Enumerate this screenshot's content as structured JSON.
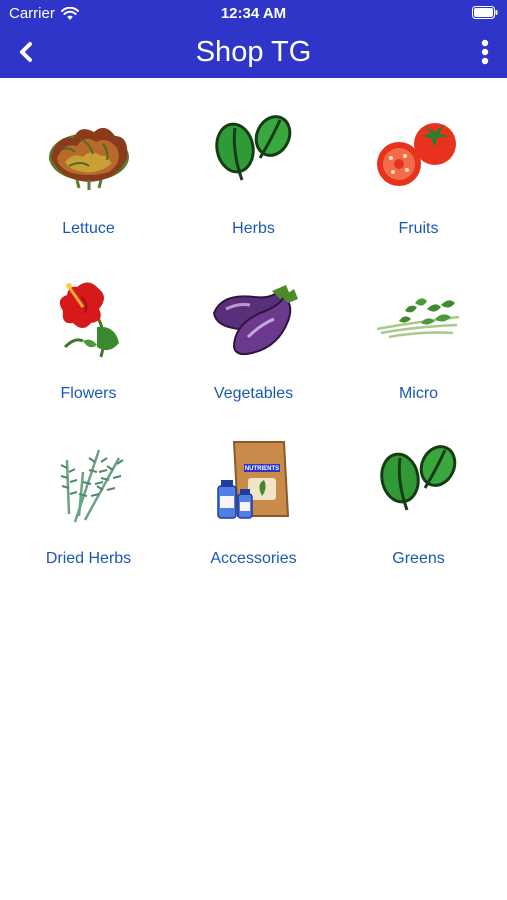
{
  "status": {
    "carrier": "Carrier",
    "time": "12:34 AM"
  },
  "header": {
    "title": "Shop TG",
    "background": "#2f35c8"
  },
  "categories": [
    {
      "label": "Lettuce",
      "icon": "lettuce-icon"
    },
    {
      "label": "Herbs",
      "icon": "herbs-icon"
    },
    {
      "label": "Fruits",
      "icon": "tomato-icon"
    },
    {
      "label": "Flowers",
      "icon": "hibiscus-icon"
    },
    {
      "label": "Vegetables",
      "icon": "eggplant-icon"
    },
    {
      "label": "Micro",
      "icon": "microgreens-icon"
    },
    {
      "label": "Dried Herbs",
      "icon": "dried-herbs-icon"
    },
    {
      "label": "Accessories",
      "icon": "nutrients-icon"
    },
    {
      "label": "Greens",
      "icon": "greens-icon"
    }
  ],
  "colors": {
    "label": "#1a58b6"
  }
}
